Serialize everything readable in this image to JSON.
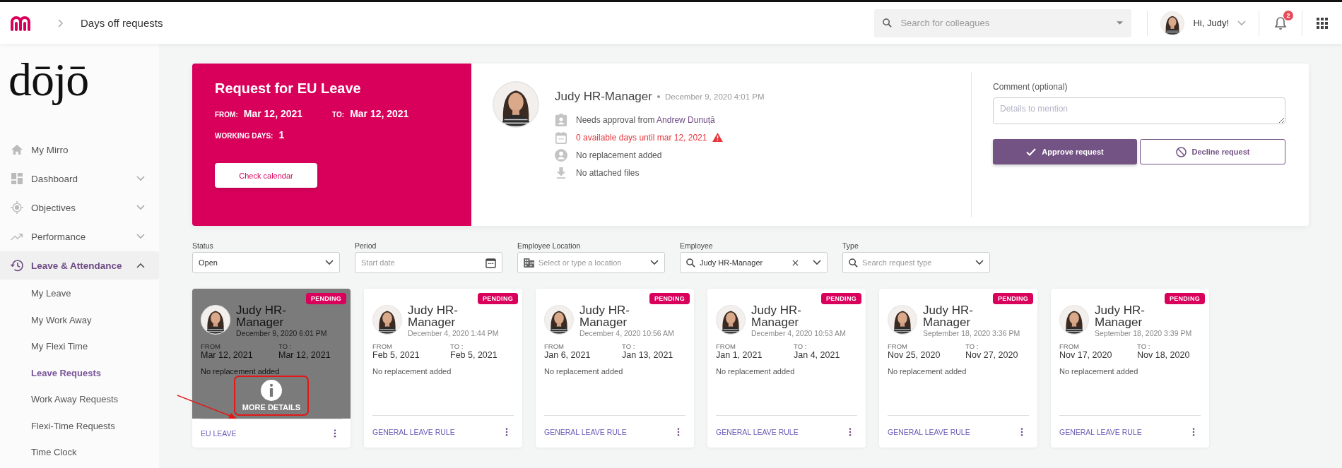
{
  "topbar": {
    "page_title": "Days off requests",
    "search": {
      "placeholder": "Search for colleagues"
    },
    "greeting": "Hi, Judy!",
    "notifications": "2"
  },
  "sidebar": {
    "logo": "dōjō",
    "items": [
      {
        "label": "My Mirro",
        "selected": false
      },
      {
        "label": "Dashboard",
        "selected": false,
        "expanded": false
      },
      {
        "label": "Objectives",
        "selected": false,
        "expanded": false
      },
      {
        "label": "Performance",
        "selected": false,
        "expanded": false
      },
      {
        "label": "Leave & Attendance",
        "selected": true,
        "expanded": true,
        "children": [
          {
            "label": "My Leave",
            "selected": false
          },
          {
            "label": "My Work Away",
            "selected": false
          },
          {
            "label": "My Flexi Time",
            "selected": false
          },
          {
            "label": "Leave Requests",
            "selected": true
          },
          {
            "label": "Work Away Requests",
            "selected": false
          },
          {
            "label": "Flexi-Time Requests",
            "selected": false
          },
          {
            "label": "Time Clock",
            "selected": false
          }
        ]
      }
    ]
  },
  "request": {
    "title": "Request for EU Leave",
    "from_label": "FROM:",
    "from": "Mar 12, 2021",
    "to_label": "TO:",
    "to": "Mar 12, 2021",
    "days_label": "WORKING DAYS:",
    "days": "1",
    "calendar_button": "Check calendar",
    "requester": "Judy HR-Manager",
    "submitted": "December 9, 2020 4:01 PM",
    "details": [
      {
        "kind": "approval",
        "text": "Needs approval from ",
        "link": "Andrew Dunuță"
      },
      {
        "kind": "warning",
        "text": "0 available days until mar 12, 2021"
      },
      {
        "kind": "replacement",
        "text": "No replacement added"
      },
      {
        "kind": "files",
        "text": "No attached files"
      }
    ],
    "comment_label": "Comment (optional)",
    "comment": {
      "placeholder": "Details to mention"
    },
    "approve_button": "Approve request",
    "decline_button": "Decline request"
  },
  "filters": [
    {
      "kind": "select",
      "label": "Status",
      "value": "Open"
    },
    {
      "kind": "date",
      "label": "Period",
      "placeholder": "Start date"
    },
    {
      "kind": "location",
      "label": "Employee Location",
      "placeholder": "Select or type a location"
    },
    {
      "kind": "employee",
      "label": "Employee",
      "value": "Judy HR-Manager"
    },
    {
      "kind": "search",
      "label": "Type",
      "placeholder": "Search request type"
    }
  ],
  "cards": [
    {
      "hovered": true,
      "overlay": "MORE DETAILS",
      "badge": "PENDING",
      "name": "Judy HR-Manager",
      "date": "December 9, 2020 6:01 PM",
      "from_label": "FROM",
      "from": "Mar 12, 2021",
      "to_label": "TO :",
      "to": "Mar 12, 2021",
      "replacement": "No replacement added",
      "type": "EU LEAVE"
    },
    {
      "hovered": false,
      "badge": "PENDING",
      "name": "Judy HR-Manager",
      "date": "December 4, 2020 1:44 PM",
      "from_label": "FROM",
      "from": "Feb 5, 2021",
      "to_label": "TO :",
      "to": "Feb 5, 2021",
      "replacement": "No replacement added",
      "type": "GENERAL LEAVE RULE"
    },
    {
      "hovered": false,
      "badge": "PENDING",
      "name": "Judy HR-Manager",
      "date": "December 4, 2020 10:56 AM",
      "from_label": "FROM",
      "from": "Jan 6, 2021",
      "to_label": "TO :",
      "to": "Jan 13, 2021",
      "replacement": "No replacement added",
      "type": "GENERAL LEAVE RULE"
    },
    {
      "hovered": false,
      "badge": "PENDING",
      "name": "Judy HR-Manager",
      "date": "December 4, 2020 10:53 AM",
      "from_label": "FROM",
      "from": "Jan 1, 2021",
      "to_label": "TO :",
      "to": "Jan 4, 2021",
      "replacement": "No replacement added",
      "type": "GENERAL LEAVE RULE"
    },
    {
      "hovered": false,
      "badge": "PENDING",
      "name": "Judy HR-Manager",
      "date": "September 18, 2020 3:36 PM",
      "from_label": "FROM",
      "from": "Nov 25, 2020",
      "to_label": "TO :",
      "to": "Nov 27, 2020",
      "replacement": "No replacement added",
      "type": "GENERAL LEAVE RULE"
    },
    {
      "hovered": false,
      "badge": "PENDING",
      "name": "Judy HR-Manager",
      "date": "September 18, 2020 3:39 PM",
      "from_label": "FROM",
      "from": "Nov 17, 2020",
      "to_label": "TO :",
      "to": "Nov 18, 2020",
      "replacement": "No replacement added",
      "type": "GENERAL LEAVE RULE"
    }
  ]
}
